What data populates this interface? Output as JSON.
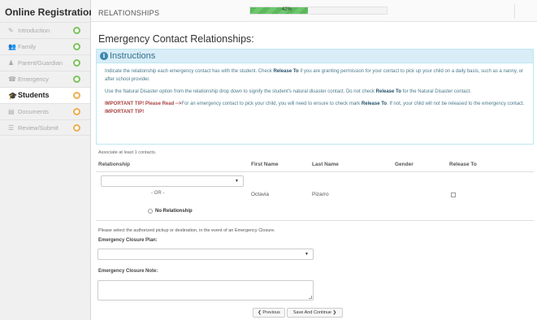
{
  "sidebar": {
    "title": "Online Registration",
    "items": [
      {
        "icon": "✎",
        "label": "Introduction",
        "status": "done",
        "active": false
      },
      {
        "icon": "👥",
        "label": "Family",
        "status": "done",
        "active": false
      },
      {
        "icon": "♟",
        "label": "Parent/Guardian",
        "status": "done",
        "active": false
      },
      {
        "icon": "☎",
        "label": "Emergency",
        "status": "done",
        "active": false
      },
      {
        "icon": "🎓",
        "label": "Students",
        "status": "warn",
        "active": true
      },
      {
        "icon": "▤",
        "label": "Documents",
        "status": "warn",
        "active": false
      },
      {
        "icon": "☰",
        "label": "Review/Submit",
        "status": "warn",
        "active": false
      }
    ]
  },
  "header": {
    "section_title": "RELATIONSHIPS",
    "progress_percent": 42,
    "progress_label": "42%"
  },
  "page_title": "Emergency Contact Relationships:",
  "instructions": {
    "title": "Instructions",
    "p1_pre": "Indicate the relationship each emergency contact has with the student. Check ",
    "p1_bold": "Release To",
    "p1_post": " if you are granting permission for your contact to pick up your child on a daily basis, such as a nanny, or after school provider.",
    "p2_pre": "Use the Natural Disaster option from the relationship drop down to signify the student's natural disaster contact. Do not check ",
    "p2_bold": "Release To",
    "p2_post": " for the Natural Disaster contact.",
    "p3_red1": "IMPORTANT TIP! Please Read -->",
    "p3_mid": "For an emergency contact to pick your child, you will need to ensure to check mark ",
    "p3_bold": "Release To",
    "p3_post": ". If not, your child will not be released to the emergency contact. ",
    "p3_red2": "IMPORTANT TIP!"
  },
  "contacts": {
    "assoc_note": "Associate at least 1 contacts.",
    "headers": {
      "relationship": "Relationship",
      "first_name": "First Name",
      "last_name": "Last Name",
      "gender": "Gender",
      "release_to": "Release To"
    },
    "row": {
      "relationship_value": "",
      "first_name": "Octavia",
      "last_name": "Pizarro",
      "gender": ""
    },
    "or_text": "- OR -",
    "no_relationship_label": "No Relationship"
  },
  "closure": {
    "note": "Please select the authorized pickup or destination, in the event of an Emergency Closure.",
    "plan_label": "Emergency Closure Plan:",
    "plan_value": "",
    "note_label": "Emergency Closure Note:",
    "note_value": ""
  },
  "buttons": {
    "previous": "❮ Previous",
    "save_continue": "Save And Continue ❯"
  },
  "colors": {
    "accent_info": "#31708f",
    "progress_green": "#5cb85c",
    "done_green": "#7bc45a",
    "pending_orange": "#f0ad4e",
    "important_red": "#a94442"
  }
}
